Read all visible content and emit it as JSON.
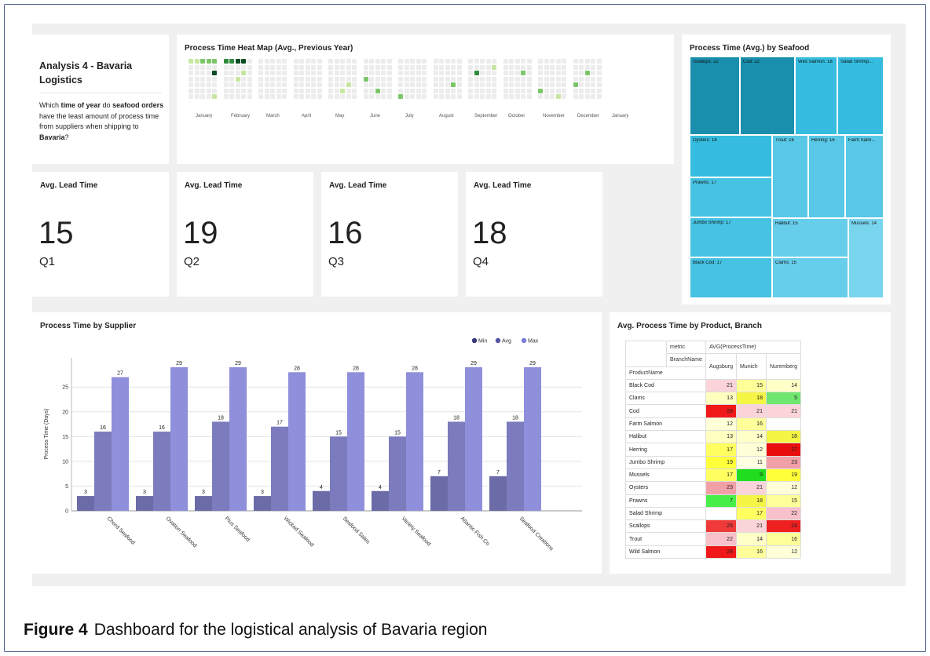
{
  "intro": {
    "title": "Analysis 4 - Bavaria Logistics",
    "text_parts": [
      "Which ",
      "time of year",
      " do ",
      "seafood orders",
      " have the least amount of process time from suppliers when shipping to ",
      "Bavaria",
      "?"
    ]
  },
  "heatmap": {
    "title": "Process Time Heat Map (Avg., Previous Year)",
    "months": [
      "January",
      "February",
      "March",
      "April",
      "May",
      "June",
      "July",
      "August",
      "September",
      "October",
      "November",
      "December",
      "January"
    ],
    "colors": {
      "empty": "#ececec",
      "low": "#c7e6a0",
      "mid": "#7cc66a",
      "high": "#2e8b3e",
      "max": "#0b4d22"
    }
  },
  "kpis": [
    {
      "label": "Avg. Lead Time",
      "value": "15",
      "quarter": "Q1"
    },
    {
      "label": "Avg. Lead Time",
      "value": "19",
      "quarter": "Q2"
    },
    {
      "label": "Avg. Lead Time",
      "value": "16",
      "quarter": "Q3"
    },
    {
      "label": "Avg. Lead Time",
      "value": "18",
      "quarter": "Q4"
    }
  ],
  "treemap": {
    "title": "Process Time (Avg.) by Seafood",
    "items": [
      {
        "label": "Scallops: 22",
        "color": "#1a8fad"
      },
      {
        "label": "Cod: 22",
        "color": "#1a8fad"
      },
      {
        "label": "Wild Salmon: 18",
        "color": "#35bcdf"
      },
      {
        "label": "Salad Shrimp...",
        "color": "#35bcdf"
      },
      {
        "label": "Oysters: 18",
        "color": "#35bcdf"
      },
      {
        "label": "Trout: 16",
        "color": "#58c8e6"
      },
      {
        "label": "Herring: 16",
        "color": "#58c8e6"
      },
      {
        "label": "Farm Salm...",
        "color": "#58c8e6"
      },
      {
        "label": "Prawns: 17",
        "color": "#46c2e2"
      },
      {
        "label": "Jumbo Shrimp: 17",
        "color": "#46c2e2"
      },
      {
        "label": "Halibut: 15",
        "color": "#66cdea"
      },
      {
        "label": "Mussels: 14",
        "color": "#79d4ee"
      },
      {
        "label": "Black Cod: 17",
        "color": "#46c2e2"
      },
      {
        "label": "Clams: 15",
        "color": "#66cdea"
      }
    ]
  },
  "chart_data": {
    "type": "bar",
    "title": "Process Time by Supplier",
    "ylabel": "Process Time (Days)",
    "ylim": [
      0,
      30
    ],
    "yticks": [
      0,
      5,
      10,
      15,
      20,
      25
    ],
    "categories": [
      "Chord Seafood",
      "Ovation Seafood",
      "Plus Seafood",
      "Wicked Seafood",
      "Seafood Sales",
      "Variety Seafood",
      "Atlantic Fish Co",
      "Seafood Creations"
    ],
    "series": [
      {
        "name": "Min",
        "color": "#6b6ba8",
        "legend_color": "#3a3a7a",
        "values": [
          3,
          3,
          3,
          3,
          4,
          4,
          7,
          7
        ]
      },
      {
        "name": "Avg",
        "color": "#7b7bbd",
        "legend_color": "#5555a8",
        "values": [
          16,
          16,
          18,
          17,
          15,
          15,
          18,
          18
        ]
      },
      {
        "name": "Max",
        "color": "#8f8fdc",
        "legend_color": "#7b7bd8",
        "values": [
          27,
          29,
          29,
          28,
          28,
          28,
          29,
          29
        ]
      }
    ],
    "legend_position": "top-right",
    "grid": true
  },
  "pivot": {
    "title": "Avg. Process Time by Product, Branch",
    "metric_label": "metric",
    "metric_value": "AVG(ProcessTime)",
    "branch_label": "BranchName",
    "product_label": "ProductName",
    "branches": [
      "Augsburg",
      "Munich",
      "Nuremberg"
    ],
    "rows": [
      {
        "name": "Black Cod",
        "values": [
          "21",
          "15",
          "14"
        ],
        "colors": [
          "#fad4d8",
          "#ffff99",
          "#ffffc8"
        ]
      },
      {
        "name": "Clams",
        "values": [
          "13",
          "18",
          "5"
        ],
        "colors": [
          "#ffffc0",
          "#f5f545",
          "#6fe66f"
        ]
      },
      {
        "name": "Cod",
        "values": [
          "28",
          "21",
          "21"
        ],
        "colors": [
          "#f01818",
          "#fad4d8",
          "#fad4d8"
        ]
      },
      {
        "name": "Farm Salmon",
        "values": [
          "12",
          "16",
          ""
        ],
        "colors": [
          "#ffffd8",
          "#ffff9a",
          "#ffffff"
        ]
      },
      {
        "name": "Halibut",
        "values": [
          "13",
          "14",
          "18"
        ],
        "colors": [
          "#ffffc0",
          "#ffffc8",
          "#f5f545"
        ]
      },
      {
        "name": "Herring",
        "values": [
          "17",
          "12",
          "27"
        ],
        "colors": [
          "#ffff60",
          "#ffffd8",
          "#e80e0e"
        ]
      },
      {
        "name": "Jumbo Shrimp",
        "values": [
          "19",
          "11",
          "23"
        ],
        "colors": [
          "#ffff3a",
          "#ffffe2",
          "#f2a0a8"
        ]
      },
      {
        "name": "Mussels",
        "values": [
          "17",
          "9",
          "19"
        ],
        "colors": [
          "#ffff60",
          "#20dd20",
          "#ffff3a"
        ]
      },
      {
        "name": "Oysters",
        "values": [
          "23",
          "21",
          "12"
        ],
        "colors": [
          "#f2a0a8",
          "#fad4d8",
          "#ffffd8"
        ]
      },
      {
        "name": "Prawns",
        "values": [
          "7",
          "18",
          "15"
        ],
        "colors": [
          "#48ee48",
          "#f5f545",
          "#ffff99"
        ]
      },
      {
        "name": "Salad Shrimp",
        "values": [
          "",
          "17",
          "22"
        ],
        "colors": [
          "#ffffff",
          "#ffff60",
          "#f8c0c8"
        ]
      },
      {
        "name": "Scallops",
        "values": [
          "26",
          "21",
          "24"
        ],
        "colors": [
          "#f03a3a",
          "#fad4d8",
          "#ee2020"
        ]
      },
      {
        "name": "Trout",
        "values": [
          "22",
          "14",
          "16"
        ],
        "colors": [
          "#f8c0c8",
          "#ffffc8",
          "#ffff9a"
        ]
      },
      {
        "name": "Wild Salmon",
        "values": [
          "28",
          "16",
          "12"
        ],
        "colors": [
          "#f01818",
          "#ffff9a",
          "#ffffd8"
        ]
      }
    ]
  },
  "caption": {
    "label": "Figure 4",
    "text": "Dashboard for the logistical analysis of Bavaria region"
  }
}
